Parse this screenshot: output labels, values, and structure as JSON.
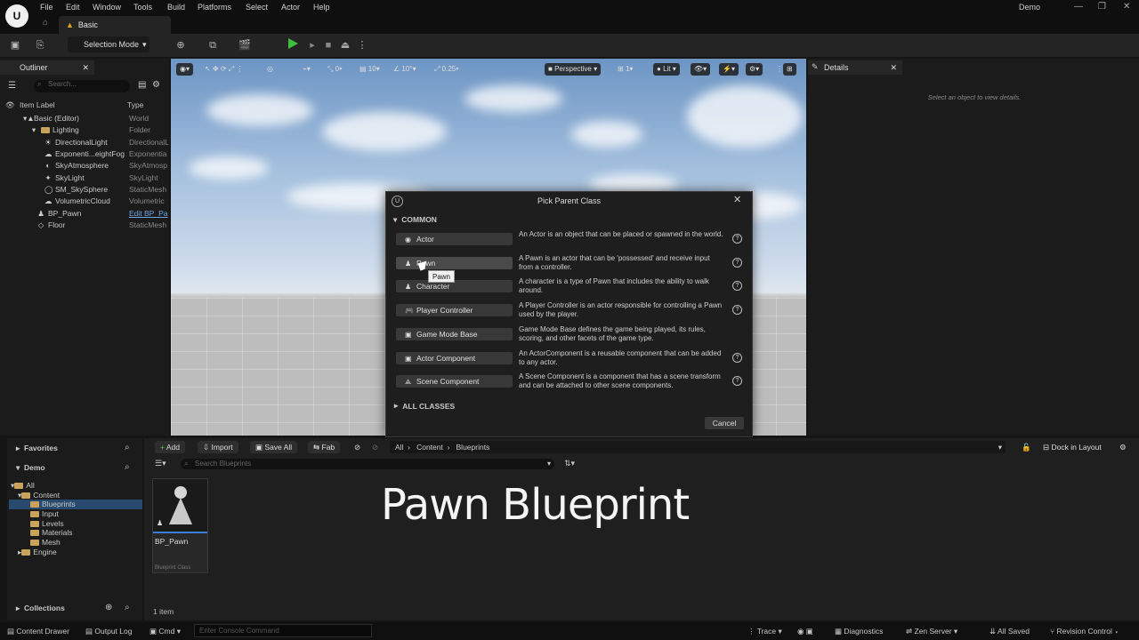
{
  "app": {
    "logo": "U",
    "project": "Demo",
    "level_tab": "Basic"
  },
  "menu": [
    "File",
    "Edit",
    "Window",
    "Tools",
    "Build",
    "Platforms",
    "Select",
    "Actor",
    "Help"
  ],
  "toolbar": {
    "selection_mode": "Selection Mode"
  },
  "outliner": {
    "tab": "Outliner",
    "search_placeholder": "Search...",
    "col_label": "Item Label",
    "col_type": "Type",
    "rows": [
      {
        "label": "Basic (Editor)",
        "type": "World"
      },
      {
        "label": "Lighting",
        "type": "Folder"
      },
      {
        "label": "DirectionalLight",
        "type": "DirectionalL"
      },
      {
        "label": "Exponenti...eightFog",
        "type": "Exponentia"
      },
      {
        "label": "SkyAtmosphere",
        "type": "SkyAtmosp"
      },
      {
        "label": "SkyLight",
        "type": "SkyLight"
      },
      {
        "label": "SM_SkySphere",
        "type": "StaticMesh"
      },
      {
        "label": "VolumetricCloud",
        "type": "Volumetric"
      },
      {
        "label": "BP_Pawn",
        "type": "Edit BP_Pa"
      },
      {
        "label": "Floor",
        "type": "StaticMesh"
      }
    ]
  },
  "viewport": {
    "snap_translate": "0",
    "grid": "10",
    "rot": "10°",
    "scale": "0.25",
    "perspective": "Perspective",
    "camera_speed": "1",
    "lit": "Lit"
  },
  "details": {
    "tab": "Details",
    "empty": "Select an object to view details."
  },
  "dialog": {
    "title": "Pick Parent Class",
    "section": "COMMON",
    "classes": [
      {
        "label": "Actor",
        "icon": "actor-icon",
        "desc": "An Actor is an object that can be placed or spawned in the world."
      },
      {
        "label": "Pawn",
        "icon": "pawn-icon",
        "desc": "A Pawn is an actor that can be 'possessed' and receive input from a controller."
      },
      {
        "label": "Character",
        "icon": "character-icon",
        "desc": "A character is a type of Pawn that includes the ability to walk around."
      },
      {
        "label": "Player Controller",
        "icon": "gamepad-icon",
        "desc": "A Player Controller is an actor responsible for controlling a Pawn used by the player."
      },
      {
        "label": "Game Mode Base",
        "icon": "gamemode-icon",
        "desc": "Game Mode Base defines the game being played, its rules, scoring, and other facets of the game type."
      },
      {
        "label": "Actor Component",
        "icon": "component-icon",
        "desc": "An ActorComponent is a reusable component that can be added to any actor."
      },
      {
        "label": "Scene Component",
        "icon": "scene-component-icon",
        "desc": "A Scene Component is a component that has a scene transform and can be attached to other scene components."
      }
    ],
    "tooltip": "Pawn",
    "all_classes": "ALL CLASSES",
    "cancel": "Cancel"
  },
  "content_browser": {
    "favorites": "Favorites",
    "project": "Demo",
    "tree": [
      "All",
      "Content",
      "Blueprints",
      "Input",
      "Levels",
      "Materials",
      "Mesh",
      "Engine"
    ],
    "collections": "Collections",
    "add": "Add",
    "import": "Import",
    "save_all": "Save All",
    "fab": "Fab",
    "path": [
      "All",
      "Content",
      "Blueprints"
    ],
    "dock": "Dock in Layout",
    "search_placeholder": "Search Blueprints",
    "asset_name": "BP_Pawn",
    "asset_type": "Blueprint Class",
    "item_count": "1 item",
    "overlay_title": "Pawn Blueprint"
  },
  "statusbar": {
    "content_drawer": "Content Drawer",
    "output_log": "Output Log",
    "cmd": "Cmd",
    "console_placeholder": "Enter Console Command",
    "trace": "Trace",
    "diagnostics": "Diagnostics",
    "zen": "Zen Server",
    "saved": "All Saved",
    "revision": "Revision Control"
  }
}
